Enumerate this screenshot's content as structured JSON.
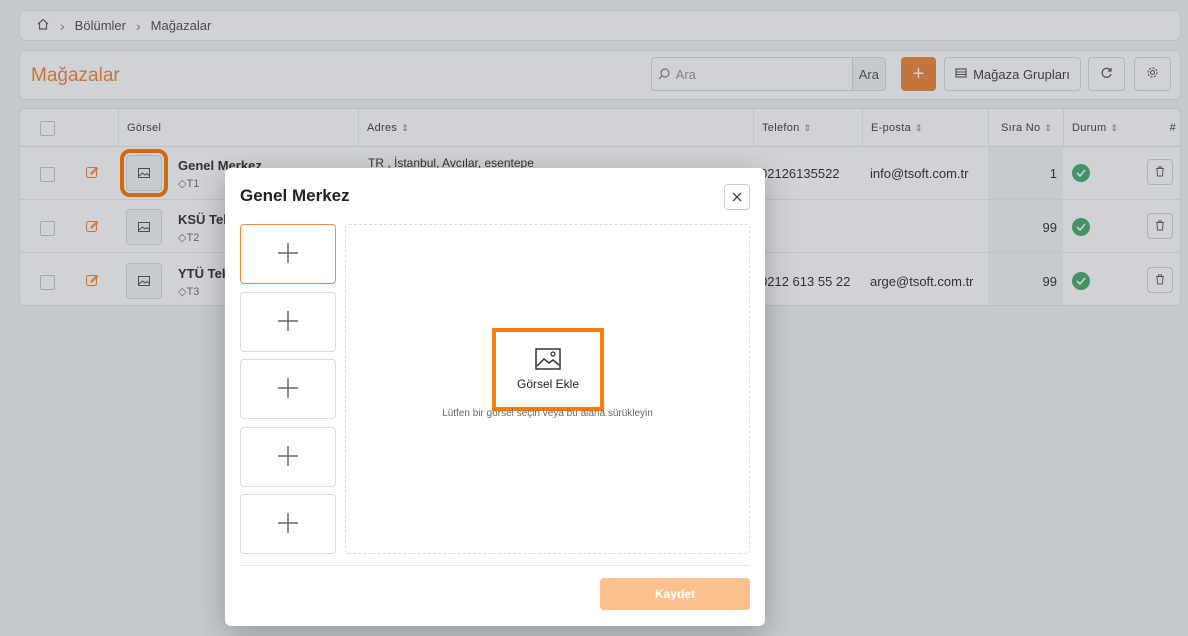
{
  "breadcrumb": {
    "items": [
      "Bölümler",
      "Mağazalar"
    ]
  },
  "header": {
    "title": "Mağazalar",
    "search_placeholder": "Ara",
    "search_button": "Ara",
    "add_label": "+",
    "groups_label": "Mağaza Grupları"
  },
  "table": {
    "columns": {
      "gorsel": "Görsel",
      "adres": "Adres",
      "telefon": "Telefon",
      "eposta": "E-posta",
      "sira": "Sıra No",
      "durum": "Durum",
      "hash": "#"
    },
    "rows": [
      {
        "name": "Genel Merkez",
        "code": "T1",
        "address": "TR , İstanbul, Avcılar, esentepe",
        "phone": "02126135522",
        "email": "info@tsoft.com.tr",
        "sira": "1"
      },
      {
        "name": "KSÜ Tek",
        "code": "T2",
        "address": "",
        "phone": "",
        "email": "",
        "sira": "99"
      },
      {
        "name": "YTÜ Tek",
        "code": "T3",
        "address": "",
        "phone": "0212 613 55 22",
        "email": "arge@tsoft.com.tr",
        "sira": "99"
      }
    ]
  },
  "modal": {
    "title": "Genel Merkez",
    "drop_label": "Görsel Ekle",
    "drop_hint": "Lütfen bir görsel seçin veya bu alana sürükleyin",
    "save_label": "Kaydet"
  },
  "colors": {
    "accent": "#f18a3c",
    "highlight": "#ff7a00",
    "success": "#4caf73"
  }
}
